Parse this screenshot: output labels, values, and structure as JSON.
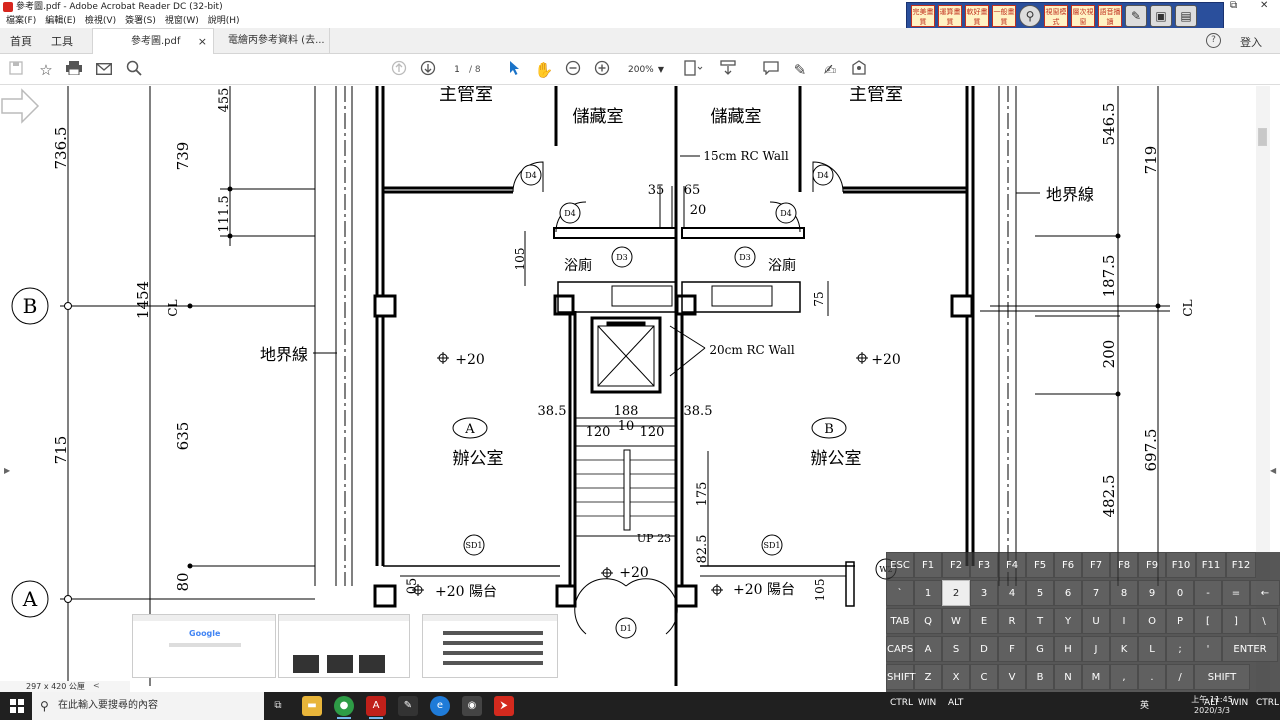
{
  "window": {
    "title": "參考圖.pdf - Adobe Acrobat Reader DC (32-bit)",
    "menu": [
      "檔案(F)",
      "編輯(E)",
      "檢視(V)",
      "簽署(S)",
      "視窗(W)",
      "說明(H)"
    ]
  },
  "reader_tools": [
    "完美畫質",
    "運算畫質",
    "軟好畫質",
    "一般畫質",
    "視窗模式",
    "層次視窗",
    "語音播讀"
  ],
  "tabs": {
    "home": "首頁",
    "tools": "工具",
    "documents": [
      {
        "label": "參考圖.pdf",
        "active": true
      },
      {
        "label": "電繪丙參考資料 (去...",
        "active": false
      }
    ],
    "close_glyph": "×",
    "login": "登入",
    "help_glyph": "?"
  },
  "toolbar": {
    "page_current": "1",
    "page_total": "/ 8",
    "zoom": "200%"
  },
  "drawing": {
    "rooms": [
      "主管室",
      "儲藏室",
      "儲藏室",
      "主管室",
      "浴廁",
      "浴廁",
      "辦公室",
      "辦公室"
    ],
    "room_refs": [
      "A",
      "B"
    ],
    "doors": [
      "D4",
      "D4",
      "D4",
      "D4",
      "D3",
      "D3",
      "SD1",
      "SD1",
      "D1",
      "W2"
    ],
    "grid_bubbles": [
      "B",
      "A"
    ],
    "property_line": "地界線",
    "notes": [
      "15cm RC Wall",
      "20cm RC Wall",
      "UP 23",
      "+20",
      "+20",
      "+20",
      "+20 陽台",
      "+20 陽台",
      "CL",
      "CL"
    ],
    "dim_left_outer": [
      "736.5",
      "1454",
      "715"
    ],
    "dim_left_inner": [
      "739",
      "635",
      "80"
    ],
    "dim_left_small": [
      "455",
      "111.5",
      "05"
    ],
    "dim_core": [
      "35",
      "65",
      "20",
      "105",
      "75",
      "38.5",
      "188",
      "38.5",
      "120",
      "10",
      "120",
      "175",
      "82.5",
      "105"
    ],
    "dim_right": [
      "546.5",
      "719",
      "187.5",
      "200",
      "697.5",
      "482.5"
    ]
  },
  "status": {
    "page_size": "297 x 420 公厘"
  },
  "keyboard": {
    "row1": [
      "ESC",
      "F1",
      "F2",
      "F3",
      "F4",
      "F5",
      "F6",
      "F7",
      "F8",
      "F9",
      "F10",
      "F11",
      "F12"
    ],
    "row2": [
      "`",
      "1",
      "2",
      "3",
      "4",
      "5",
      "6",
      "7",
      "8",
      "9",
      "0",
      "-",
      "=",
      "←"
    ],
    "row3": [
      "TAB",
      "Q",
      "W",
      "E",
      "R",
      "T",
      "Y",
      "U",
      "I",
      "O",
      "P",
      "[",
      "]",
      "\\"
    ],
    "row4": [
      "CAPS",
      "A",
      "S",
      "D",
      "F",
      "G",
      "H",
      "J",
      "K",
      "L",
      ";",
      "'",
      "ENTER"
    ],
    "row5": [
      "SHIFT",
      "Z",
      "X",
      "C",
      "V",
      "B",
      "N",
      "M",
      ",",
      ".",
      "/",
      "SHIFT"
    ],
    "row6": [
      "CTRL",
      "WIN",
      "ALT",
      "ALT",
      "WIN",
      "CTRL"
    ]
  },
  "taskbar": {
    "search_placeholder": "在此輸入要搜尋的內容",
    "ime": "英",
    "time": "上午 11:45",
    "date": "2020/3/3"
  }
}
